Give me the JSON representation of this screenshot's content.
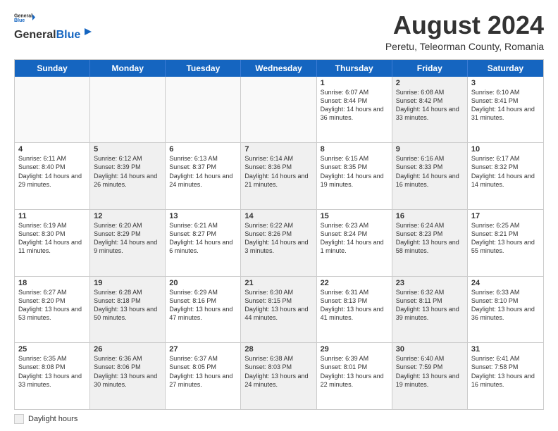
{
  "header": {
    "logo_line1": "General",
    "logo_line2": "Blue",
    "month_year": "August 2024",
    "location": "Peretu, Teleorman County, Romania"
  },
  "days_of_week": [
    "Sunday",
    "Monday",
    "Tuesday",
    "Wednesday",
    "Thursday",
    "Friday",
    "Saturday"
  ],
  "footer": {
    "daylight_label": "Daylight hours"
  },
  "weeks": [
    [
      {
        "day": "",
        "sunrise": "",
        "sunset": "",
        "daylight": "",
        "shaded": false,
        "empty": true
      },
      {
        "day": "",
        "sunrise": "",
        "sunset": "",
        "daylight": "",
        "shaded": false,
        "empty": true
      },
      {
        "day": "",
        "sunrise": "",
        "sunset": "",
        "daylight": "",
        "shaded": false,
        "empty": true
      },
      {
        "day": "",
        "sunrise": "",
        "sunset": "",
        "daylight": "",
        "shaded": false,
        "empty": true
      },
      {
        "day": "1",
        "sunrise": "Sunrise: 6:07 AM",
        "sunset": "Sunset: 8:44 PM",
        "daylight": "Daylight: 14 hours and 36 minutes.",
        "shaded": false,
        "empty": false
      },
      {
        "day": "2",
        "sunrise": "Sunrise: 6:08 AM",
        "sunset": "Sunset: 8:42 PM",
        "daylight": "Daylight: 14 hours and 33 minutes.",
        "shaded": true,
        "empty": false
      },
      {
        "day": "3",
        "sunrise": "Sunrise: 6:10 AM",
        "sunset": "Sunset: 8:41 PM",
        "daylight": "Daylight: 14 hours and 31 minutes.",
        "shaded": false,
        "empty": false
      }
    ],
    [
      {
        "day": "4",
        "sunrise": "Sunrise: 6:11 AM",
        "sunset": "Sunset: 8:40 PM",
        "daylight": "Daylight: 14 hours and 29 minutes.",
        "shaded": false,
        "empty": false
      },
      {
        "day": "5",
        "sunrise": "Sunrise: 6:12 AM",
        "sunset": "Sunset: 8:39 PM",
        "daylight": "Daylight: 14 hours and 26 minutes.",
        "shaded": true,
        "empty": false
      },
      {
        "day": "6",
        "sunrise": "Sunrise: 6:13 AM",
        "sunset": "Sunset: 8:37 PM",
        "daylight": "Daylight: 14 hours and 24 minutes.",
        "shaded": false,
        "empty": false
      },
      {
        "day": "7",
        "sunrise": "Sunrise: 6:14 AM",
        "sunset": "Sunset: 8:36 PM",
        "daylight": "Daylight: 14 hours and 21 minutes.",
        "shaded": true,
        "empty": false
      },
      {
        "day": "8",
        "sunrise": "Sunrise: 6:15 AM",
        "sunset": "Sunset: 8:35 PM",
        "daylight": "Daylight: 14 hours and 19 minutes.",
        "shaded": false,
        "empty": false
      },
      {
        "day": "9",
        "sunrise": "Sunrise: 6:16 AM",
        "sunset": "Sunset: 8:33 PM",
        "daylight": "Daylight: 14 hours and 16 minutes.",
        "shaded": true,
        "empty": false
      },
      {
        "day": "10",
        "sunrise": "Sunrise: 6:17 AM",
        "sunset": "Sunset: 8:32 PM",
        "daylight": "Daylight: 14 hours and 14 minutes.",
        "shaded": false,
        "empty": false
      }
    ],
    [
      {
        "day": "11",
        "sunrise": "Sunrise: 6:19 AM",
        "sunset": "Sunset: 8:30 PM",
        "daylight": "Daylight: 14 hours and 11 minutes.",
        "shaded": false,
        "empty": false
      },
      {
        "day": "12",
        "sunrise": "Sunrise: 6:20 AM",
        "sunset": "Sunset: 8:29 PM",
        "daylight": "Daylight: 14 hours and 9 minutes.",
        "shaded": true,
        "empty": false
      },
      {
        "day": "13",
        "sunrise": "Sunrise: 6:21 AM",
        "sunset": "Sunset: 8:27 PM",
        "daylight": "Daylight: 14 hours and 6 minutes.",
        "shaded": false,
        "empty": false
      },
      {
        "day": "14",
        "sunrise": "Sunrise: 6:22 AM",
        "sunset": "Sunset: 8:26 PM",
        "daylight": "Daylight: 14 hours and 3 minutes.",
        "shaded": true,
        "empty": false
      },
      {
        "day": "15",
        "sunrise": "Sunrise: 6:23 AM",
        "sunset": "Sunset: 8:24 PM",
        "daylight": "Daylight: 14 hours and 1 minute.",
        "shaded": false,
        "empty": false
      },
      {
        "day": "16",
        "sunrise": "Sunrise: 6:24 AM",
        "sunset": "Sunset: 8:23 PM",
        "daylight": "Daylight: 13 hours and 58 minutes.",
        "shaded": true,
        "empty": false
      },
      {
        "day": "17",
        "sunrise": "Sunrise: 6:25 AM",
        "sunset": "Sunset: 8:21 PM",
        "daylight": "Daylight: 13 hours and 55 minutes.",
        "shaded": false,
        "empty": false
      }
    ],
    [
      {
        "day": "18",
        "sunrise": "Sunrise: 6:27 AM",
        "sunset": "Sunset: 8:20 PM",
        "daylight": "Daylight: 13 hours and 53 minutes.",
        "shaded": false,
        "empty": false
      },
      {
        "day": "19",
        "sunrise": "Sunrise: 6:28 AM",
        "sunset": "Sunset: 8:18 PM",
        "daylight": "Daylight: 13 hours and 50 minutes.",
        "shaded": true,
        "empty": false
      },
      {
        "day": "20",
        "sunrise": "Sunrise: 6:29 AM",
        "sunset": "Sunset: 8:16 PM",
        "daylight": "Daylight: 13 hours and 47 minutes.",
        "shaded": false,
        "empty": false
      },
      {
        "day": "21",
        "sunrise": "Sunrise: 6:30 AM",
        "sunset": "Sunset: 8:15 PM",
        "daylight": "Daylight: 13 hours and 44 minutes.",
        "shaded": true,
        "empty": false
      },
      {
        "day": "22",
        "sunrise": "Sunrise: 6:31 AM",
        "sunset": "Sunset: 8:13 PM",
        "daylight": "Daylight: 13 hours and 41 minutes.",
        "shaded": false,
        "empty": false
      },
      {
        "day": "23",
        "sunrise": "Sunrise: 6:32 AM",
        "sunset": "Sunset: 8:11 PM",
        "daylight": "Daylight: 13 hours and 39 minutes.",
        "shaded": true,
        "empty": false
      },
      {
        "day": "24",
        "sunrise": "Sunrise: 6:33 AM",
        "sunset": "Sunset: 8:10 PM",
        "daylight": "Daylight: 13 hours and 36 minutes.",
        "shaded": false,
        "empty": false
      }
    ],
    [
      {
        "day": "25",
        "sunrise": "Sunrise: 6:35 AM",
        "sunset": "Sunset: 8:08 PM",
        "daylight": "Daylight: 13 hours and 33 minutes.",
        "shaded": false,
        "empty": false
      },
      {
        "day": "26",
        "sunrise": "Sunrise: 6:36 AM",
        "sunset": "Sunset: 8:06 PM",
        "daylight": "Daylight: 13 hours and 30 minutes.",
        "shaded": true,
        "empty": false
      },
      {
        "day": "27",
        "sunrise": "Sunrise: 6:37 AM",
        "sunset": "Sunset: 8:05 PM",
        "daylight": "Daylight: 13 hours and 27 minutes.",
        "shaded": false,
        "empty": false
      },
      {
        "day": "28",
        "sunrise": "Sunrise: 6:38 AM",
        "sunset": "Sunset: 8:03 PM",
        "daylight": "Daylight: 13 hours and 24 minutes.",
        "shaded": true,
        "empty": false
      },
      {
        "day": "29",
        "sunrise": "Sunrise: 6:39 AM",
        "sunset": "Sunset: 8:01 PM",
        "daylight": "Daylight: 13 hours and 22 minutes.",
        "shaded": false,
        "empty": false
      },
      {
        "day": "30",
        "sunrise": "Sunrise: 6:40 AM",
        "sunset": "Sunset: 7:59 PM",
        "daylight": "Daylight: 13 hours and 19 minutes.",
        "shaded": true,
        "empty": false
      },
      {
        "day": "31",
        "sunrise": "Sunrise: 6:41 AM",
        "sunset": "Sunset: 7:58 PM",
        "daylight": "Daylight: 13 hours and 16 minutes.",
        "shaded": false,
        "empty": false
      }
    ]
  ]
}
